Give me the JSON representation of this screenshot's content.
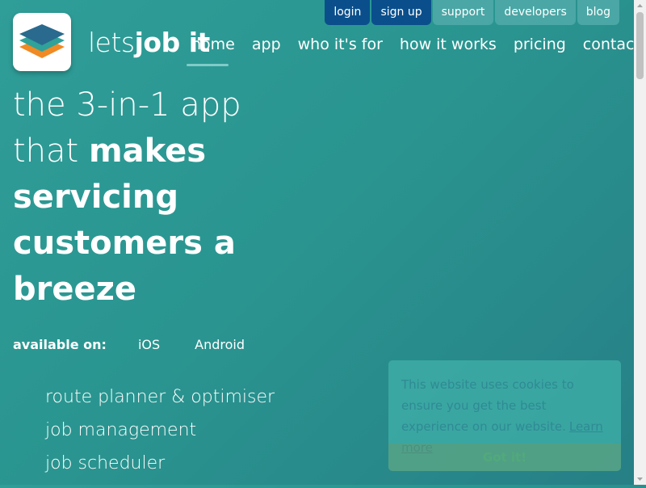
{
  "topbar": {
    "login": "login",
    "signup": "sign up",
    "support": "support",
    "developers": "developers",
    "blog": "blog"
  },
  "brand": {
    "lets": "lets",
    "job": "job it"
  },
  "nav": {
    "home": "home",
    "app": "app",
    "who": "who it's for",
    "how": "how it works",
    "pricing": "pricing",
    "contact": "contact"
  },
  "hero": {
    "line1": "the 3-in-1 app",
    "line2_light": "that ",
    "line2_bold": "makes",
    "line3": "servicing",
    "line4": "customers a",
    "line5": "breeze"
  },
  "available": {
    "label": "available on:",
    "ios": "iOS",
    "android": "Android"
  },
  "features": [
    "route planner & optimiser",
    "job management",
    "job scheduler"
  ],
  "cookie": {
    "message": "This website uses cookies to ensure you get the best experience on our website.",
    "link": "Learn more",
    "button": "Got it!"
  },
  "colors": {
    "background": "#2a9590",
    "login_bg": "#0a4f8c",
    "teal_tab_bg": "#4aa7a5",
    "logo_blue": "#2a6a8e",
    "logo_teal": "#2fa29a",
    "logo_orange": "#f08a24"
  },
  "icons": {
    "logo": "stacked-layers-logo"
  }
}
